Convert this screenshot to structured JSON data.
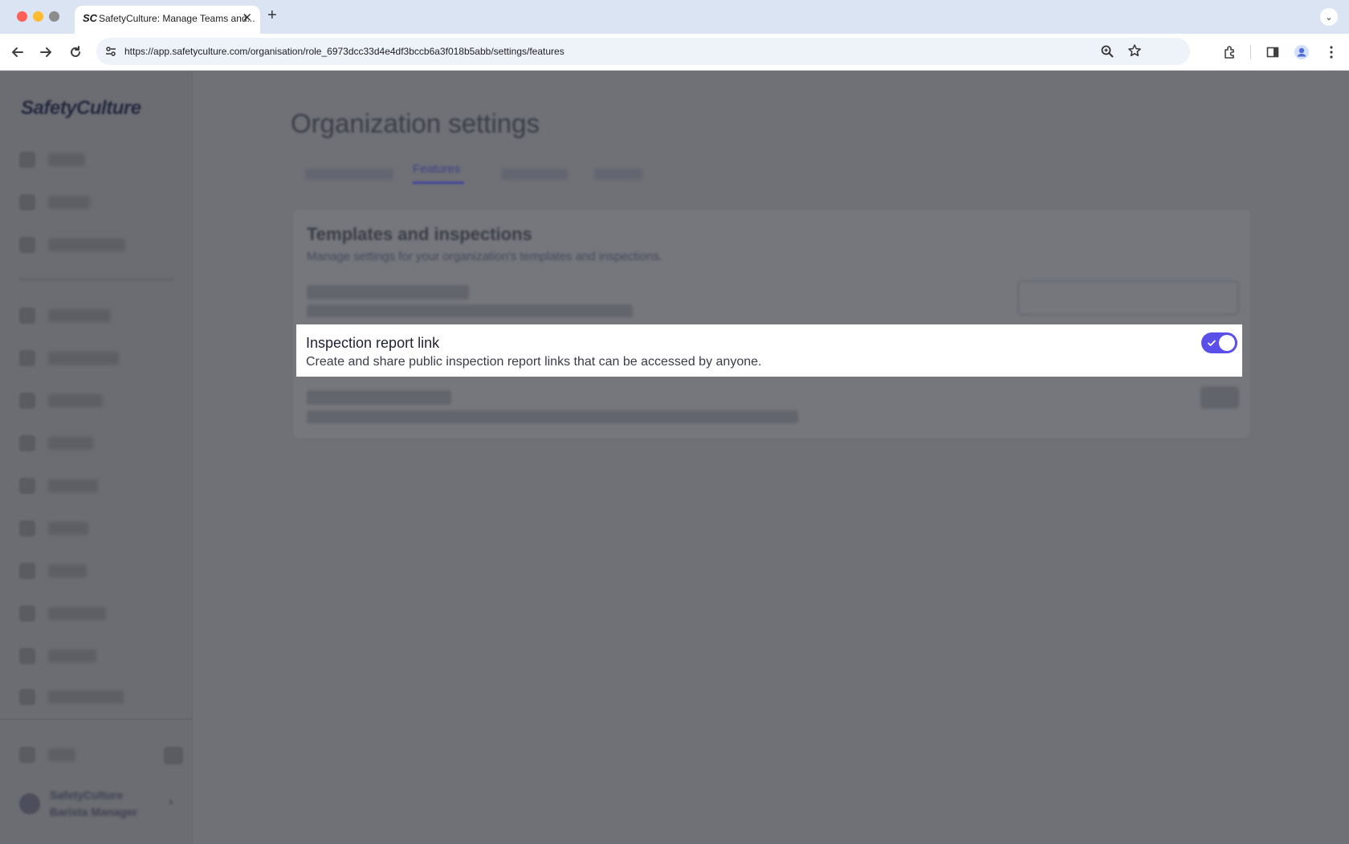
{
  "browser": {
    "tab_title": "SafetyCulture: Manage Teams and...",
    "tab_favicon": "SC",
    "url": "https://app.safetyculture.com/organisation/role_6973dcc33d4e4df3bccb6a3f018b5abb/settings/features",
    "icons": [
      "back-icon",
      "forward-icon",
      "reload-icon",
      "site-info-icon",
      "zoom-icon",
      "star-icon",
      "extensions-icon",
      "side-panel-icon",
      "profile-icon",
      "more-icon"
    ]
  },
  "sidebar": {
    "logo": "SafetyCulture",
    "user_name": "SafetyCulture",
    "user_role": "Barista Manager"
  },
  "main": {
    "page_title": "Organization settings",
    "active_tab": "Features",
    "card_title": "Templates and inspections",
    "card_subtitle": "Manage settings for your organization's templates and inspections."
  },
  "highlight": {
    "title": "Inspection report link",
    "description": "Create and share public inspection report links that can be accessed by anyone.",
    "toggle_on": true,
    "toggle_color": "#5b4fe9"
  }
}
